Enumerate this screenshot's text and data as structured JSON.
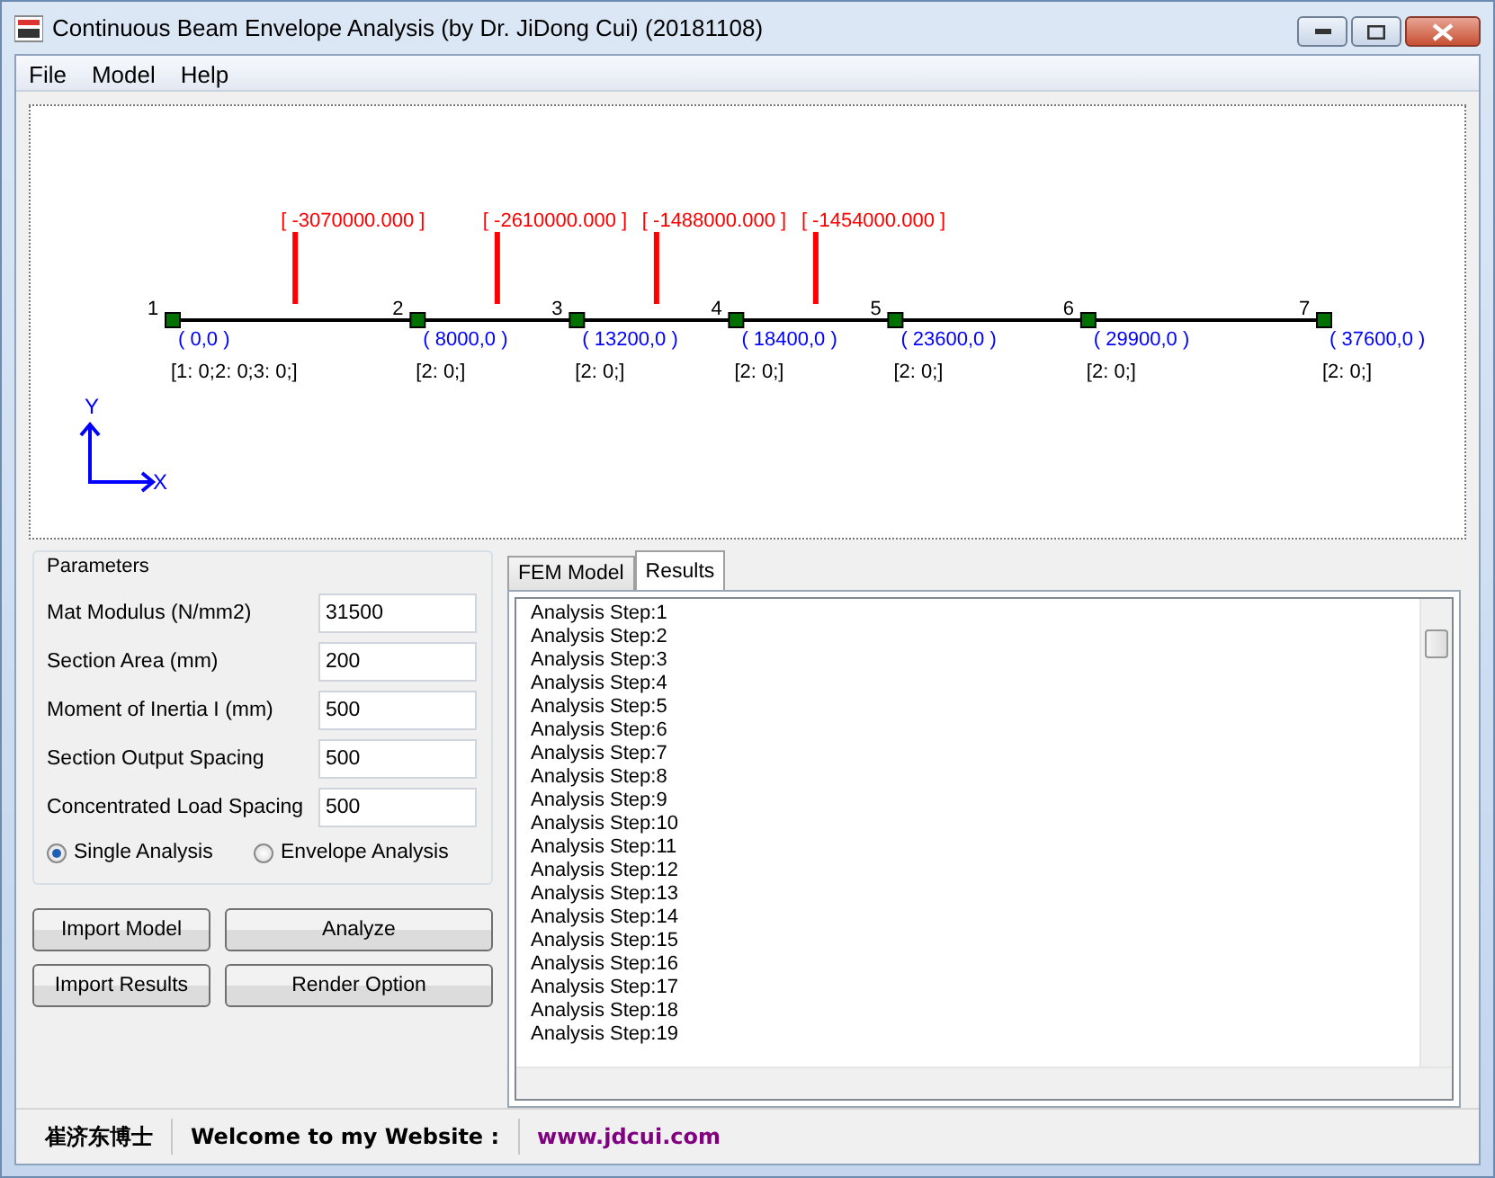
{
  "window": {
    "title": "Continuous Beam Envelope Analysis (by Dr. JiDong Cui) (20181108)"
  },
  "menu": [
    "File",
    "Model",
    "Help"
  ],
  "model": {
    "nodes": [
      {
        "label": "1",
        "coord": "( 0,0 )",
        "restraint": "[1: 0;2: 0;3: 0;]"
      },
      {
        "label": "2",
        "coord": "( 8000,0 )",
        "restraint": "[2: 0;]"
      },
      {
        "label": "3",
        "coord": "( 13200,0 )",
        "restraint": "[2: 0;]"
      },
      {
        "label": "4",
        "coord": "( 18400,0 )",
        "restraint": "[2: 0;]"
      },
      {
        "label": "5",
        "coord": "( 23600,0 )",
        "restraint": "[2: 0;]"
      },
      {
        "label": "6",
        "coord": "( 29900,0 )",
        "restraint": "[2: 0;]"
      },
      {
        "label": "7",
        "coord": "( 37600,0 )",
        "restraint": "[2: 0;]"
      }
    ],
    "span_loads": [
      "[ -3070000.000 ]",
      "[ -2610000.000 ]",
      "[ -1488000.000 ]",
      "[ -1454000.000 ]"
    ],
    "axes": {
      "x": "X",
      "y": "Y"
    }
  },
  "parameters": {
    "title": "Parameters",
    "fields": [
      {
        "label": "Mat Modulus (N/mm2)",
        "value": "31500"
      },
      {
        "label": "Section Area  (mm)",
        "value": "200"
      },
      {
        "label": "Moment of Inertia I (mm)",
        "value": "500"
      },
      {
        "label": "Section Output Spacing",
        "value": "500"
      },
      {
        "label": "Concentrated Load Spacing",
        "value": "500"
      }
    ],
    "modes": [
      {
        "label": "Single Analysis",
        "selected": true
      },
      {
        "label": "Envelope Analysis",
        "selected": false
      }
    ]
  },
  "buttons": [
    {
      "label": "Import Model",
      "kind": "small"
    },
    {
      "label": "Analyze",
      "kind": "wide"
    },
    {
      "label": "Import Results",
      "kind": "small"
    },
    {
      "label": "Render Option",
      "kind": "wide"
    }
  ],
  "tabs": [
    {
      "label": "FEM Model",
      "selected": false
    },
    {
      "label": "Results",
      "selected": true
    }
  ],
  "results": [
    "Analysis Step:1",
    "Analysis Step:2",
    "Analysis Step:3",
    "Analysis Step:4",
    "Analysis Step:5",
    "Analysis Step:6",
    "Analysis Step:7",
    "Analysis Step:8",
    "Analysis Step:9",
    "Analysis Step:10",
    "Analysis Step:11",
    "Analysis Step:12",
    "Analysis Step:13",
    "Analysis Step:14",
    "Analysis Step:15",
    "Analysis Step:16",
    "Analysis Step:17",
    "Analysis Step:18",
    "Analysis Step:19"
  ],
  "status_bar": {
    "author": "崔济东博士",
    "welcome": "Welcome to my Website :",
    "link": "www.jdcui.com"
  }
}
